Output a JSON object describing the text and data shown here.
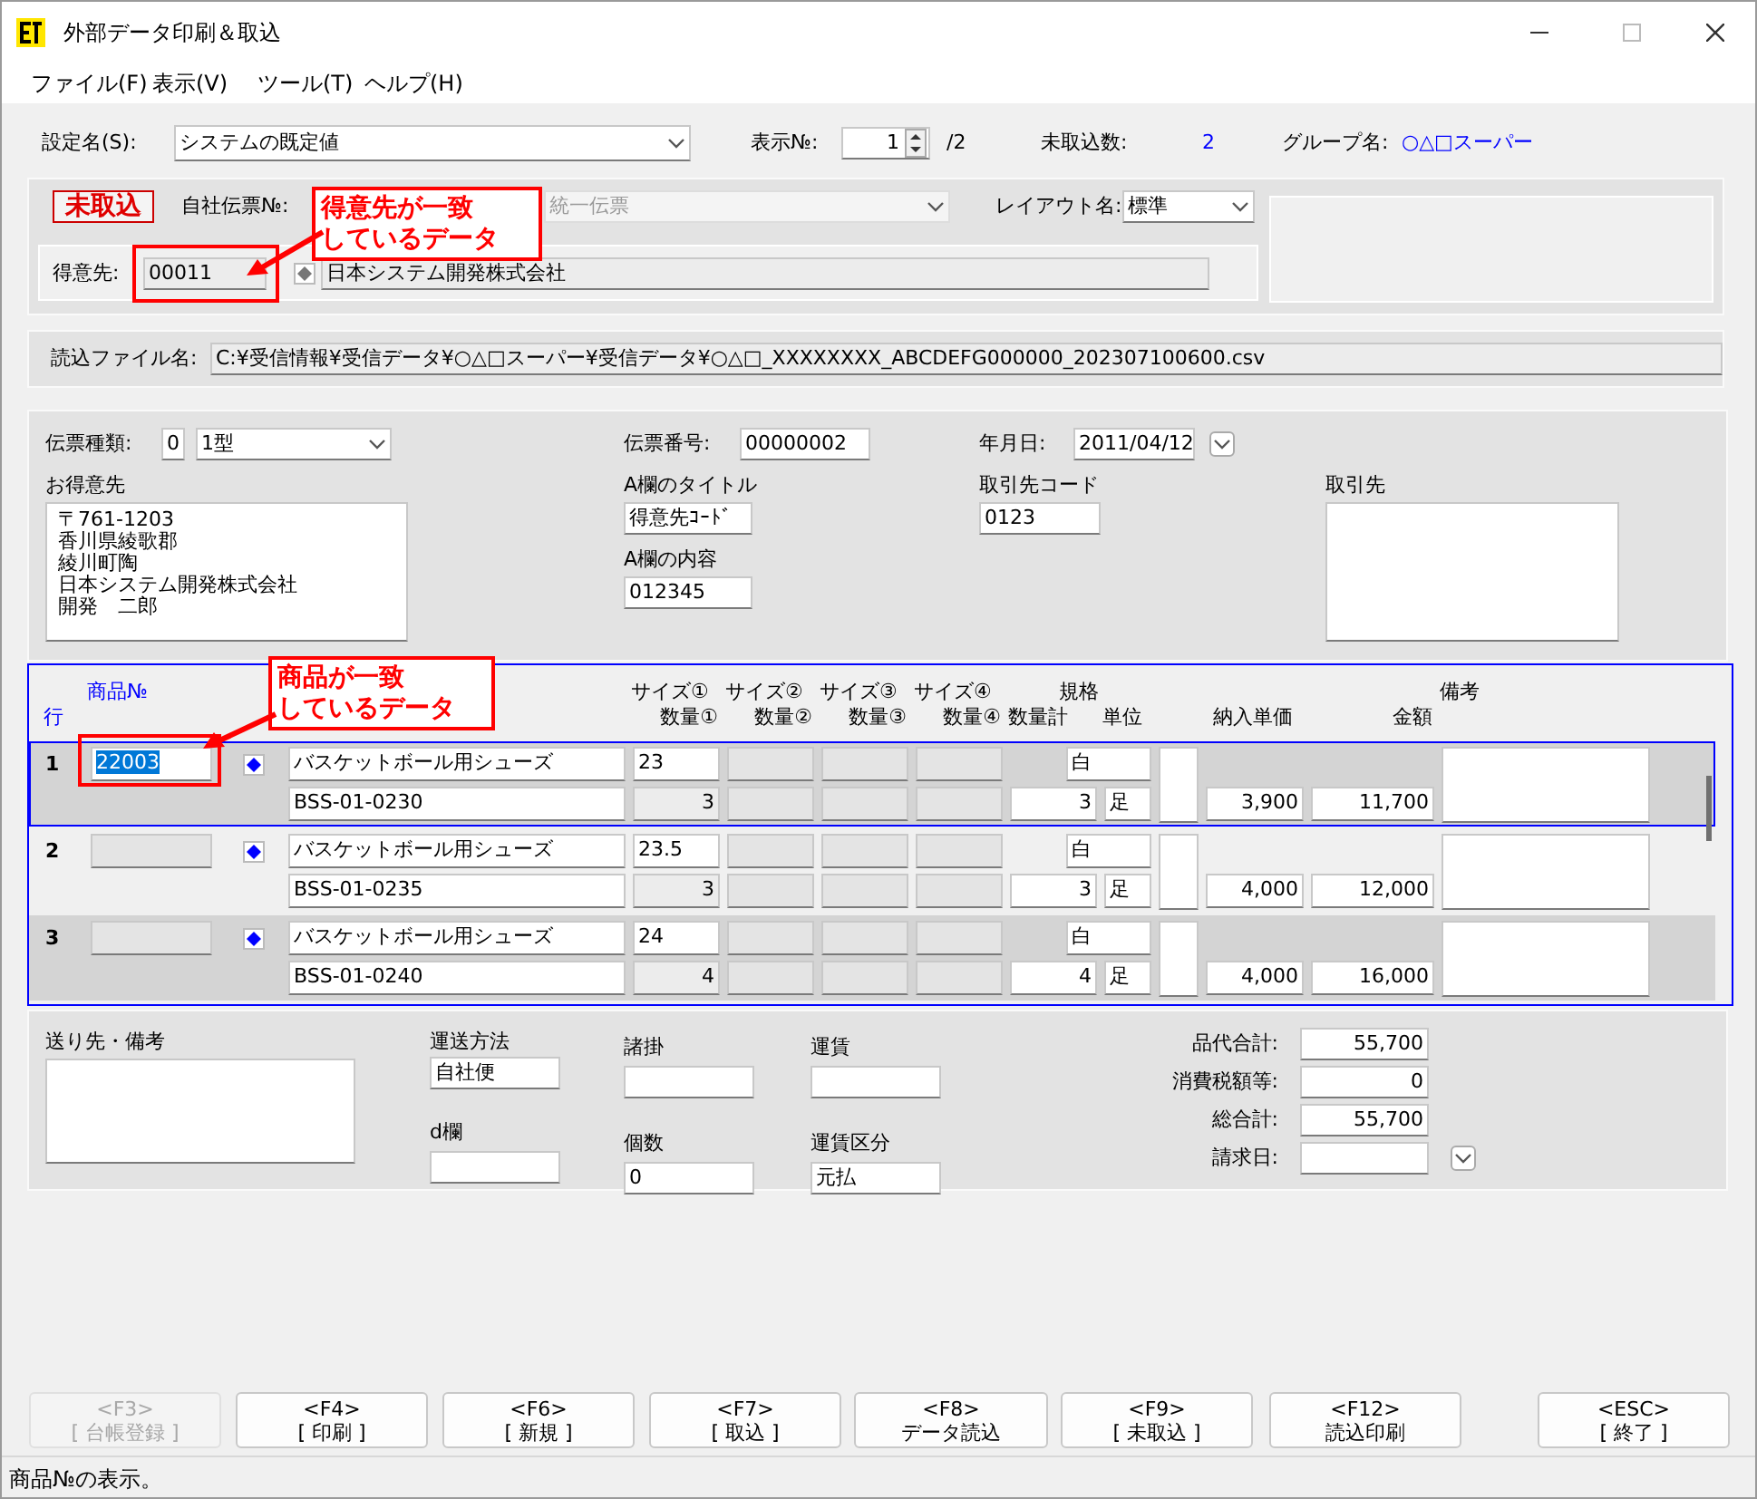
{
  "window": {
    "title": "外部データ印刷＆取込"
  },
  "menu": [
    "ファイル(F)",
    "表示(V)",
    "ツール(T)",
    "ヘルプ(H)"
  ],
  "settings": {
    "label": "設定名(S):",
    "value": "システムの既定値",
    "display_no_label": "表示№:",
    "display_no": "1",
    "display_total": "/2",
    "pending_label": "未取込数:",
    "pending_count": "2",
    "group_label": "グループ名:",
    "group_name": "○△□スーパー"
  },
  "import_header": {
    "status_badge": "未取込",
    "own_slip_label": "自社伝票№:",
    "own_slip_value": "統一伝票",
    "layout_label": "レイアウト名:",
    "layout_value": "標準",
    "customer_label": "得意先:",
    "customer_code": "00011",
    "customer_name": "日本システム開発株式会社"
  },
  "file": {
    "label": "読込ファイル名:",
    "path": "C:¥受信情報¥受信データ¥○△□スーパー¥受信データ¥○△□_XXXXXXXX_ABCDEFG000000_202307100600.csv"
  },
  "slip": {
    "type_label": "伝票種類:",
    "type_code": "0",
    "type_value": "1型",
    "number_label": "伝票番号:",
    "number": "00000002",
    "date_label": "年月日:",
    "date": "2011/04/12",
    "customer_label": "お得意先",
    "customer_address": [
      "〒761-1203",
      "香川県綾歌郡",
      "綾川町陶",
      "日本システム開発株式会社",
      "開発　二郎"
    ],
    "a_title_label": "A欄のタイトル",
    "a_title": "得意先ｺｰﾄﾞ",
    "a_content_label": "A欄の内容",
    "a_content": "012345",
    "partner_code_label": "取引先コード",
    "partner_code": "0123",
    "partner_label": "取引先"
  },
  "table": {
    "header": {
      "row": "行",
      "product_no": "商品№",
      "sizes": [
        "サイズ①",
        "サイズ②",
        "サイズ③",
        "サイズ④"
      ],
      "quantities": [
        "数量①",
        "数量②",
        "数量③",
        "数量④"
      ],
      "spec": "規格",
      "total_qty": "数量計",
      "unit": "単位",
      "unit_price": "納入単価",
      "amount": "金額",
      "remarks": "備考"
    },
    "rows": [
      {
        "no": "1",
        "selected": true,
        "product_no": "22003",
        "name": "バスケットボール用シューズ",
        "code": "BSS-01-0230",
        "size_1": "23",
        "qty_1": "3",
        "spec": "白",
        "total_qty": "3",
        "unit": "足",
        "unit_price": "3,900",
        "amount": "11,700"
      },
      {
        "no": "2",
        "selected": false,
        "name": "バスケットボール用シューズ",
        "code": "BSS-01-0235",
        "size_1": "23.5",
        "qty_1": "3",
        "spec": "白",
        "total_qty": "3",
        "unit": "足",
        "unit_price": "4,000",
        "amount": "12,000"
      },
      {
        "no": "3",
        "selected": false,
        "name": "バスケットボール用シューズ",
        "code": "BSS-01-0240",
        "size_1": "24",
        "qty_1": "4",
        "spec": "白",
        "total_qty": "4",
        "unit": "足",
        "unit_price": "4,000",
        "amount": "16,000"
      }
    ]
  },
  "summary": {
    "remarks_label": "送り先・備考",
    "shipping_label": "運送方法",
    "shipping": "自社便",
    "d_label": "d欄",
    "charges_label": "諸掛",
    "pieces_label": "個数",
    "pieces": "0",
    "freight_label": "運賃",
    "freight_type_label": "運賃区分",
    "freight_type": "元払",
    "totals": [
      {
        "label": "品代合計:",
        "value": "55,700"
      },
      {
        "label": "消費税額等:",
        "value": "0"
      },
      {
        "label": "総合計:",
        "value": "55,700"
      }
    ],
    "billing_date_label": "請求日:"
  },
  "buttons": [
    {
      "key": "<F3>",
      "label": "[ 台帳登録 ]",
      "disabled": true
    },
    {
      "key": "<F4>",
      "label": "[ 印刷 ]",
      "disabled": false
    },
    {
      "key": "<F6>",
      "label": "[ 新規 ]",
      "disabled": false
    },
    {
      "key": "<F7>",
      "label": "[ 取込 ]",
      "disabled": false
    },
    {
      "key": "<F8>",
      "label": "データ読込",
      "disabled": false
    },
    {
      "key": "<F9>",
      "label": "[ 未取込 ]",
      "disabled": false
    },
    {
      "key": "<F12>",
      "label": "読込印刷",
      "disabled": false
    },
    {
      "key": "<ESC>",
      "label": "[ 終了 ]",
      "disabled": false
    }
  ],
  "status_bar": "商品№の表示。",
  "callouts": [
    {
      "lines": [
        "得意先が一致",
        "しているデータ"
      ]
    },
    {
      "lines": [
        "商品が一致",
        "しているデータ"
      ]
    }
  ]
}
